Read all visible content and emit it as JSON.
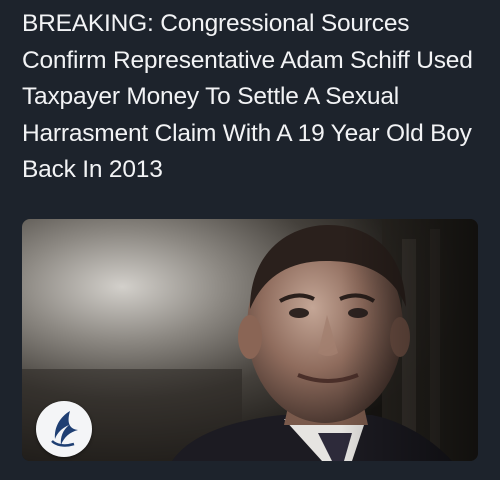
{
  "post": {
    "headline": "BREAKING: Congressional Sources Confirm Representative Adam Schiff Used Taxpayer Money To Settle A Sexual Harrasment Claim With A 19 Year Old Boy Back In 2013"
  },
  "colors": {
    "background": "#1d232c",
    "headline_text": "#f2f3f5",
    "logo_badge": "#f4f5f7",
    "logo_mark": "#1f3f73"
  },
  "icons": {
    "logo": "stylized-wing-logo-icon"
  }
}
